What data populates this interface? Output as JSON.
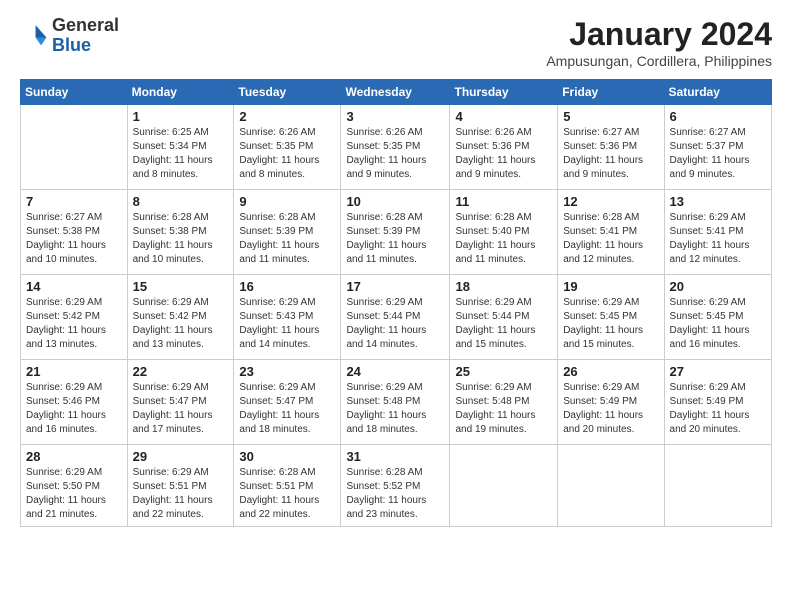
{
  "header": {
    "logo_general": "General",
    "logo_blue": "Blue",
    "month_title": "January 2024",
    "subtitle": "Ampusungan, Cordillera, Philippines"
  },
  "weekdays": [
    "Sunday",
    "Monday",
    "Tuesday",
    "Wednesday",
    "Thursday",
    "Friday",
    "Saturday"
  ],
  "weeks": [
    [
      {
        "day": "",
        "info": ""
      },
      {
        "day": "1",
        "info": "Sunrise: 6:25 AM\nSunset: 5:34 PM\nDaylight: 11 hours\nand 8 minutes."
      },
      {
        "day": "2",
        "info": "Sunrise: 6:26 AM\nSunset: 5:35 PM\nDaylight: 11 hours\nand 8 minutes."
      },
      {
        "day": "3",
        "info": "Sunrise: 6:26 AM\nSunset: 5:35 PM\nDaylight: 11 hours\nand 9 minutes."
      },
      {
        "day": "4",
        "info": "Sunrise: 6:26 AM\nSunset: 5:36 PM\nDaylight: 11 hours\nand 9 minutes."
      },
      {
        "day": "5",
        "info": "Sunrise: 6:27 AM\nSunset: 5:36 PM\nDaylight: 11 hours\nand 9 minutes."
      },
      {
        "day": "6",
        "info": "Sunrise: 6:27 AM\nSunset: 5:37 PM\nDaylight: 11 hours\nand 9 minutes."
      }
    ],
    [
      {
        "day": "7",
        "info": "Sunrise: 6:27 AM\nSunset: 5:38 PM\nDaylight: 11 hours\nand 10 minutes."
      },
      {
        "day": "8",
        "info": "Sunrise: 6:28 AM\nSunset: 5:38 PM\nDaylight: 11 hours\nand 10 minutes."
      },
      {
        "day": "9",
        "info": "Sunrise: 6:28 AM\nSunset: 5:39 PM\nDaylight: 11 hours\nand 11 minutes."
      },
      {
        "day": "10",
        "info": "Sunrise: 6:28 AM\nSunset: 5:39 PM\nDaylight: 11 hours\nand 11 minutes."
      },
      {
        "day": "11",
        "info": "Sunrise: 6:28 AM\nSunset: 5:40 PM\nDaylight: 11 hours\nand 11 minutes."
      },
      {
        "day": "12",
        "info": "Sunrise: 6:28 AM\nSunset: 5:41 PM\nDaylight: 11 hours\nand 12 minutes."
      },
      {
        "day": "13",
        "info": "Sunrise: 6:29 AM\nSunset: 5:41 PM\nDaylight: 11 hours\nand 12 minutes."
      }
    ],
    [
      {
        "day": "14",
        "info": "Sunrise: 6:29 AM\nSunset: 5:42 PM\nDaylight: 11 hours\nand 13 minutes."
      },
      {
        "day": "15",
        "info": "Sunrise: 6:29 AM\nSunset: 5:42 PM\nDaylight: 11 hours\nand 13 minutes."
      },
      {
        "day": "16",
        "info": "Sunrise: 6:29 AM\nSunset: 5:43 PM\nDaylight: 11 hours\nand 14 minutes."
      },
      {
        "day": "17",
        "info": "Sunrise: 6:29 AM\nSunset: 5:44 PM\nDaylight: 11 hours\nand 14 minutes."
      },
      {
        "day": "18",
        "info": "Sunrise: 6:29 AM\nSunset: 5:44 PM\nDaylight: 11 hours\nand 15 minutes."
      },
      {
        "day": "19",
        "info": "Sunrise: 6:29 AM\nSunset: 5:45 PM\nDaylight: 11 hours\nand 15 minutes."
      },
      {
        "day": "20",
        "info": "Sunrise: 6:29 AM\nSunset: 5:45 PM\nDaylight: 11 hours\nand 16 minutes."
      }
    ],
    [
      {
        "day": "21",
        "info": "Sunrise: 6:29 AM\nSunset: 5:46 PM\nDaylight: 11 hours\nand 16 minutes."
      },
      {
        "day": "22",
        "info": "Sunrise: 6:29 AM\nSunset: 5:47 PM\nDaylight: 11 hours\nand 17 minutes."
      },
      {
        "day": "23",
        "info": "Sunrise: 6:29 AM\nSunset: 5:47 PM\nDaylight: 11 hours\nand 18 minutes."
      },
      {
        "day": "24",
        "info": "Sunrise: 6:29 AM\nSunset: 5:48 PM\nDaylight: 11 hours\nand 18 minutes."
      },
      {
        "day": "25",
        "info": "Sunrise: 6:29 AM\nSunset: 5:48 PM\nDaylight: 11 hours\nand 19 minutes."
      },
      {
        "day": "26",
        "info": "Sunrise: 6:29 AM\nSunset: 5:49 PM\nDaylight: 11 hours\nand 20 minutes."
      },
      {
        "day": "27",
        "info": "Sunrise: 6:29 AM\nSunset: 5:49 PM\nDaylight: 11 hours\nand 20 minutes."
      }
    ],
    [
      {
        "day": "28",
        "info": "Sunrise: 6:29 AM\nSunset: 5:50 PM\nDaylight: 11 hours\nand 21 minutes."
      },
      {
        "day": "29",
        "info": "Sunrise: 6:29 AM\nSunset: 5:51 PM\nDaylight: 11 hours\nand 22 minutes."
      },
      {
        "day": "30",
        "info": "Sunrise: 6:28 AM\nSunset: 5:51 PM\nDaylight: 11 hours\nand 22 minutes."
      },
      {
        "day": "31",
        "info": "Sunrise: 6:28 AM\nSunset: 5:52 PM\nDaylight: 11 hours\nand 23 minutes."
      },
      {
        "day": "",
        "info": ""
      },
      {
        "day": "",
        "info": ""
      },
      {
        "day": "",
        "info": ""
      }
    ]
  ]
}
